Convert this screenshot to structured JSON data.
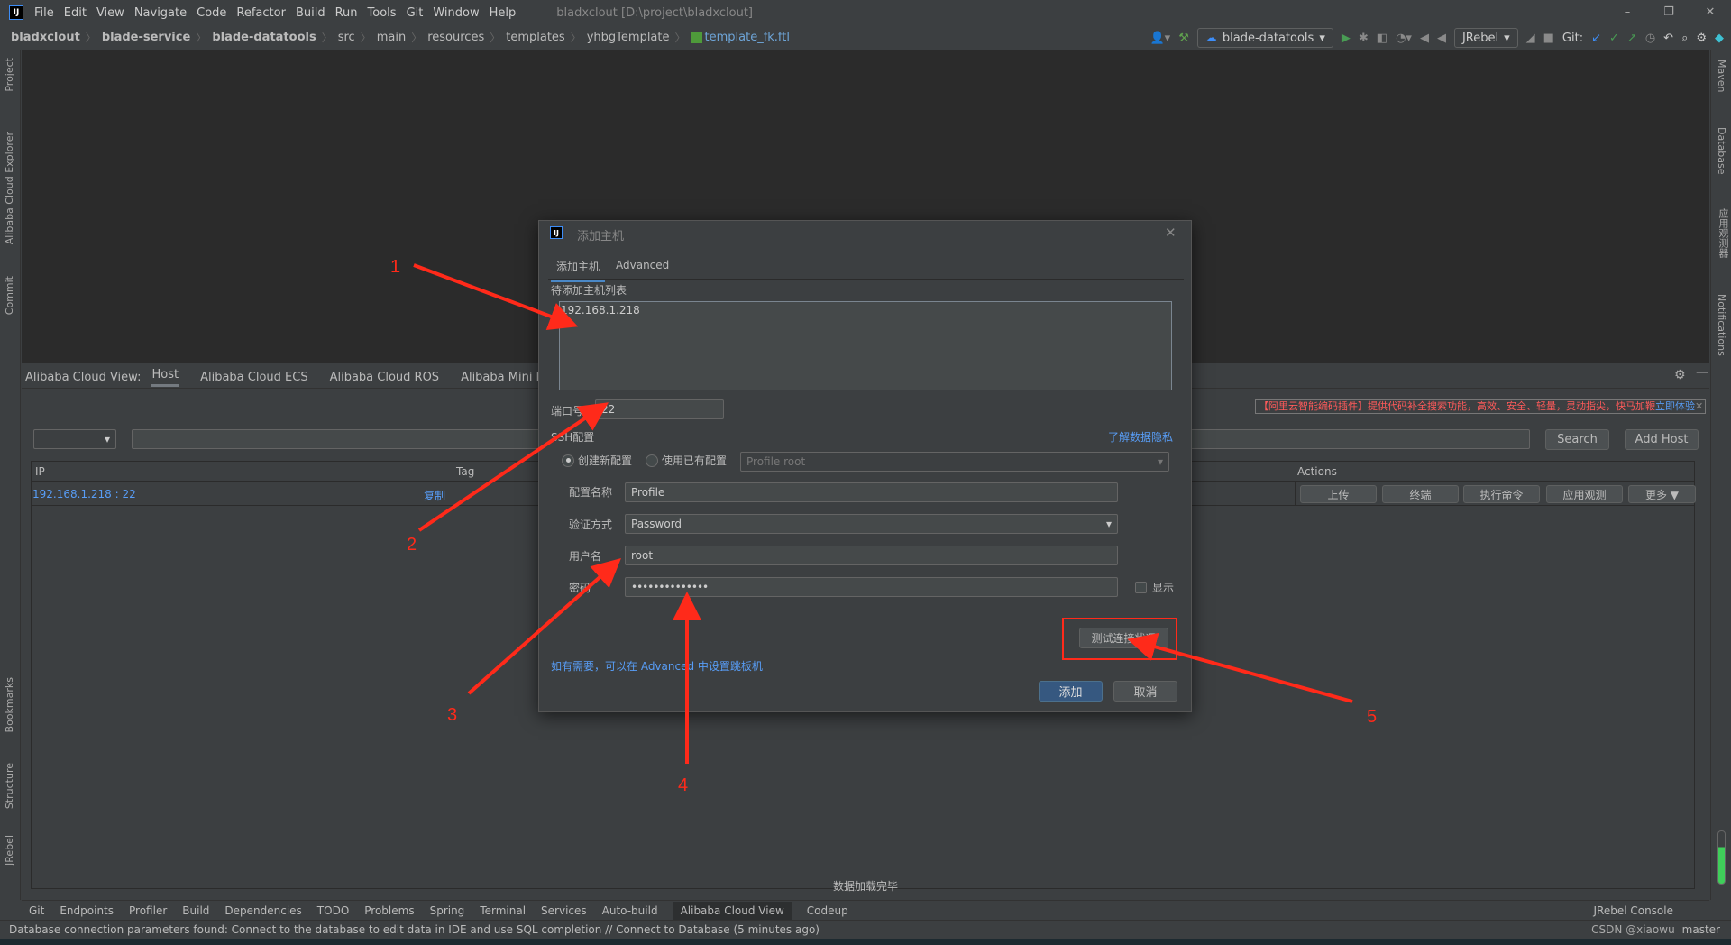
{
  "window": {
    "title": "bladxclout [D:\\project\\bladxclout]",
    "logo": "IJ",
    "controls": [
      "–",
      "❐",
      "✕"
    ]
  },
  "menu": [
    "File",
    "Edit",
    "View",
    "Navigate",
    "Code",
    "Refactor",
    "Build",
    "Run",
    "Tools",
    "Git",
    "Window",
    "Help"
  ],
  "breadcrumb": [
    {
      "label": "bladxclout",
      "bold": true
    },
    {
      "label": "blade-service",
      "bold": true
    },
    {
      "label": "blade-datatools",
      "bold": true
    },
    {
      "label": "src"
    },
    {
      "label": "main"
    },
    {
      "label": "resources"
    },
    {
      "label": "templates"
    },
    {
      "label": "yhbgTemplate"
    },
    {
      "label": "template_fk.ftl",
      "file": true
    }
  ],
  "toolbar": {
    "run_config": "blade-datatools",
    "jrebel": "JRebel",
    "git_label": "Git:"
  },
  "left_stripe": [
    "Project",
    "Alibaba Cloud Explorer",
    "Commit",
    "Bookmarks",
    "Structure",
    "JRebel"
  ],
  "right_stripe": [
    "Maven",
    "Database",
    "应用观测器",
    "Notifications"
  ],
  "toolwindow": {
    "prefix": "Alibaba Cloud View:",
    "tabs": [
      "Host",
      "Alibaba Cloud ECS",
      "Alibaba Cloud ROS",
      "Alibaba Mini Progra"
    ],
    "active_tab": "Host",
    "banner": "【阿里云智能编码插件】提供代码补全搜索功能，高效、安全、轻量，灵动指尖，快马加鞭",
    "banner_link": "立即体验",
    "search_button": "Search",
    "add_host_button": "Add Host",
    "columns": {
      "ip": "IP",
      "tag": "Tag",
      "actions": "Actions"
    },
    "rows": [
      {
        "ip": "192.168.1.218 : 22",
        "copy": "复制",
        "actions": [
          "上传",
          "终端",
          "执行命令",
          "应用观测",
          "更多 ▼"
        ]
      }
    ],
    "footer": "数据加载完毕"
  },
  "dialog": {
    "title": "添加主机",
    "tabs": [
      "添加主机",
      "Advanced"
    ],
    "host_list_label": "待添加主机列表",
    "host_list_value": "192.168.1.218",
    "port_label": "端口号",
    "port_value": "22",
    "ssh_label": "SSH配置",
    "privacy_link": "了解数据隐私",
    "radio_new": "创建新配置",
    "radio_existing": "使用已有配置",
    "radio_selected": "创建新配置",
    "existing_profile": "Profile root",
    "profile_label": "配置名称",
    "profile_value": "Profile",
    "auth_label": "验证方式",
    "auth_value": "Password",
    "user_label": "用户名",
    "user_value": "root",
    "password_label": "密码",
    "password_value": "••••••••••••••",
    "show_label": "显示",
    "show_checked": false,
    "test_button": "测试连接状况",
    "hint": "如有需要，可以在 Advanced 中设置跳板机",
    "add_button": "添加",
    "cancel_button": "取消"
  },
  "annotations": [
    "1",
    "2",
    "3",
    "4",
    "5"
  ],
  "annotation_color": "#ff2a1a",
  "bottom_tabs": [
    "Git",
    "Endpoints",
    "Profiler",
    "Build",
    "Dependencies",
    "TODO",
    "Problems",
    "Spring",
    "Terminal",
    "Services",
    "Auto-build",
    "Alibaba Cloud View",
    "Codeup"
  ],
  "bottom_active": "Alibaba Cloud View",
  "jrebel_console": "JRebel Console",
  "status": {
    "message": "Database connection parameters found: Connect to the database to edit data in IDE and use SQL completion // Connect to Database (5 minutes ago)",
    "branch": "master",
    "watermark": "CSDN @xiaowu"
  }
}
